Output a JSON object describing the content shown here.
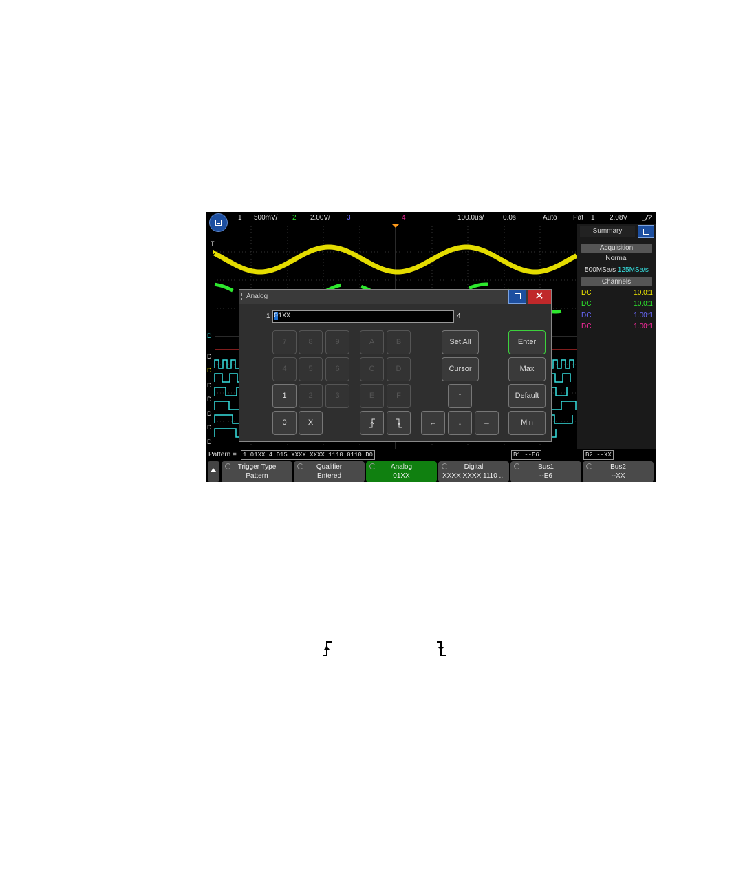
{
  "status_bar": {
    "ch1_num": "1",
    "ch1_scale": "500mV/",
    "ch2_num": "2",
    "ch2_scale": "2.00V/",
    "ch3_num": "3",
    "ch4_num": "4",
    "timebase": "100.0us/",
    "delay": "0.0s",
    "trigger_mode": "Auto",
    "trigger_type": "Pat",
    "trigger_src": "1",
    "trigger_level": "2.08V",
    "colors": {
      "ch1": "#f0e800",
      "ch2": "#2ee82e",
      "ch3": "#6a6aff",
      "ch4": "#ff2aa0"
    }
  },
  "right_panel": {
    "tab": "Summary",
    "acquisition_header": "Acquisition",
    "acq_mode": "Normal",
    "sample_rate": "500MSa/s",
    "digital_rate": "125MSa/s",
    "channels_header": "Channels",
    "channels": [
      {
        "coupling": "DC",
        "probe": "10.0:1",
        "color": "#f0e800"
      },
      {
        "coupling": "DC",
        "probe": "10.0:1",
        "color": "#2ee82e"
      },
      {
        "coupling": "DC",
        "probe": "1.00:1",
        "color": "#6a6aff"
      },
      {
        "coupling": "DC",
        "probe": "1.00:1",
        "color": "#ff2aa0"
      }
    ]
  },
  "channel_labels": {
    "d_labels": [
      "D",
      "D",
      "D",
      "D",
      "D",
      "D",
      "D",
      "D"
    ],
    "marker_t": "T"
  },
  "dialog": {
    "title": "Analog",
    "left_index": "1",
    "right_index": "4",
    "cursor_char": "0",
    "pattern_rest": "1XX",
    "keys": {
      "k7": "7",
      "k8": "8",
      "k9": "9",
      "kA": "A",
      "kB": "B",
      "k4": "4",
      "k5": "5",
      "k6": "6",
      "kC": "C",
      "kD": "D",
      "k1": "1",
      "k2": "2",
      "k3": "3",
      "kE": "E",
      "kF": "F",
      "k0": "0",
      "kX": "X",
      "rise": "⨍",
      "fall": "ʖ",
      "set_all": "Set All",
      "cursor": "Cursor",
      "up": "↑",
      "left": "←",
      "down": "↓",
      "right": "→",
      "enter": "Enter",
      "max": "Max",
      "default": "Default",
      "min": "Min"
    }
  },
  "pattern_line": {
    "label": "Pattern =",
    "pattern": "1 01XX 4 D15 XXXX XXXX 1110 0110 D0",
    "bus1": "B1 --E6",
    "bus2": "B2 --XX"
  },
  "softkeys": [
    {
      "l1": "Trigger Type",
      "l2": "Pattern"
    },
    {
      "l1": "Qualifier",
      "l2": "Entered"
    },
    {
      "l1": "Analog",
      "l2": "01XX"
    },
    {
      "l1": "Digital",
      "l2": "XXXX XXXX 1110 ..."
    },
    {
      "l1": "Bus1",
      "l2": "--E6"
    },
    {
      "l1": "Bus2",
      "l2": "--XX"
    }
  ]
}
